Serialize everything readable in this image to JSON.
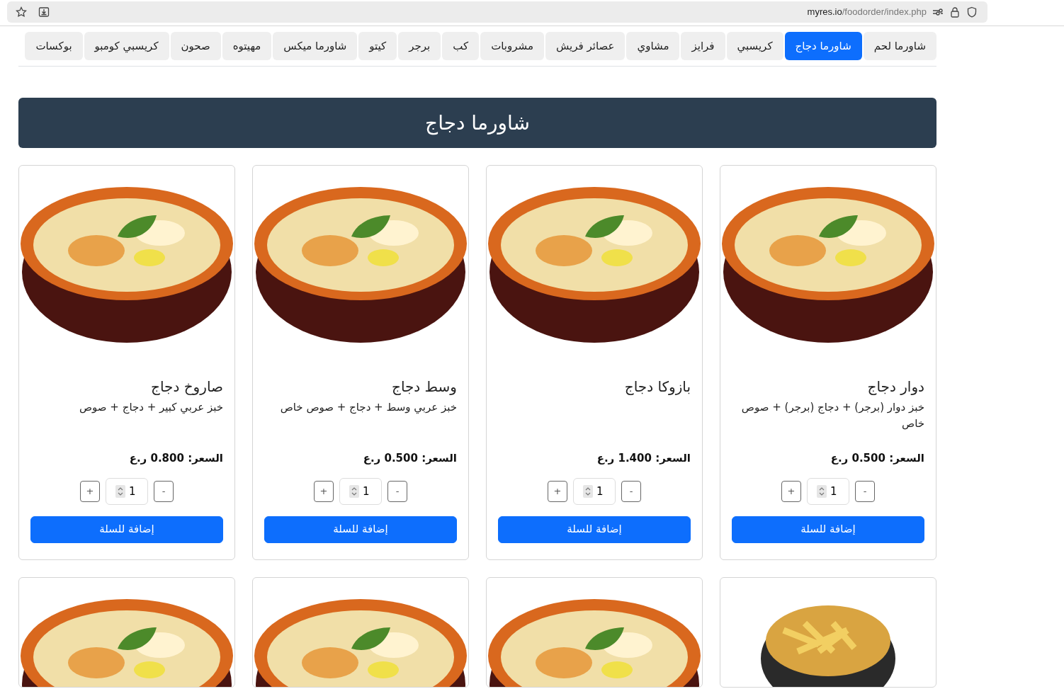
{
  "browser": {
    "url_host": "myres.io",
    "url_path": "/foodorder/index.php"
  },
  "tabs": [
    {
      "label": "شاورما لحم",
      "selected": false
    },
    {
      "label": "شاورما دجاج",
      "selected": true
    },
    {
      "label": "كريسبي",
      "selected": false
    },
    {
      "label": "فرايز",
      "selected": false
    },
    {
      "label": "مشاوي",
      "selected": false
    },
    {
      "label": "عصائر فريش",
      "selected": false
    },
    {
      "label": "مشروبات",
      "selected": false
    },
    {
      "label": "كب",
      "selected": false
    },
    {
      "label": "برجر",
      "selected": false
    },
    {
      "label": "كيتو",
      "selected": false
    },
    {
      "label": "شاورما ميكس",
      "selected": false
    },
    {
      "label": "مهيتوه",
      "selected": false
    },
    {
      "label": "صحون",
      "selected": false
    },
    {
      "label": "كريسبي كومبو",
      "selected": false
    },
    {
      "label": "بوكسات",
      "selected": false
    }
  ],
  "section_title": "شاورما دجاج",
  "products": [
    {
      "kind": "gratin",
      "name": "دوار دجاج",
      "description": "خبز دوار (برجر) + دجاج (برجر) + صوص خاص",
      "price": "السعر: 0.500 ر.ع",
      "quantity": "1",
      "minus": "-",
      "plus": "+",
      "button": "إضافة للسلة"
    },
    {
      "kind": "gratin",
      "name": "بازوكا دجاج",
      "price": "السعر: 1.400 ر.ع",
      "quantity": "1",
      "minus": "-",
      "plus": "+",
      "button": "إضافة للسلة"
    },
    {
      "kind": "gratin",
      "name": "وسط دجاج",
      "description": "خبز عربي وسط + دجاج + صوص خاص",
      "price": "السعر: 0.500 ر.ع",
      "quantity": "1",
      "minus": "-",
      "plus": "+",
      "button": "إضافة للسلة"
    },
    {
      "kind": "gratin",
      "name": "صاروخ دجاج",
      "description": "خبز عربي كبير + دجاج + صوص",
      "price": "السعر: 0.800 ر.ع",
      "quantity": "1",
      "minus": "-",
      "plus": "+",
      "button": "إضافة للسلة"
    },
    {
      "kind": "fries"
    },
    {
      "kind": "gratin"
    },
    {
      "kind": "gratin"
    },
    {
      "kind": "gratin"
    }
  ]
}
